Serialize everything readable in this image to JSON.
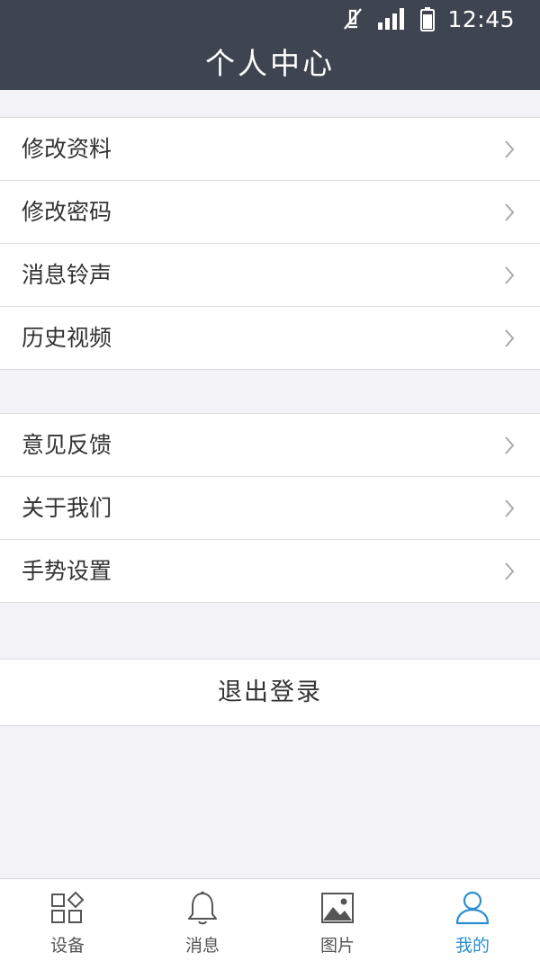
{
  "status_bar": {
    "time": "12:45",
    "icons": [
      "mute-icon",
      "signal-icon",
      "battery-icon"
    ]
  },
  "header": {
    "title": "个人中心"
  },
  "menu_group_1": {
    "items": [
      {
        "label": "修改资料"
      },
      {
        "label": "修改密码"
      },
      {
        "label": "消息铃声"
      },
      {
        "label": "历史视频"
      }
    ]
  },
  "menu_group_2": {
    "items": [
      {
        "label": "意见反馈"
      },
      {
        "label": "关于我们"
      },
      {
        "label": "手势设置"
      }
    ]
  },
  "logout": {
    "label": "退出登录"
  },
  "tabbar": {
    "active_index": 3,
    "tabs": [
      {
        "label": "设备",
        "icon": "devices-icon"
      },
      {
        "label": "消息",
        "icon": "bell-icon"
      },
      {
        "label": "图片",
        "icon": "picture-icon"
      },
      {
        "label": "我的",
        "icon": "person-icon"
      }
    ]
  },
  "colors": {
    "header_bg": "#3f4451",
    "page_bg": "#f2f2f7",
    "active_tab": "#2a8fd0",
    "inactive_tab": "#555555"
  }
}
